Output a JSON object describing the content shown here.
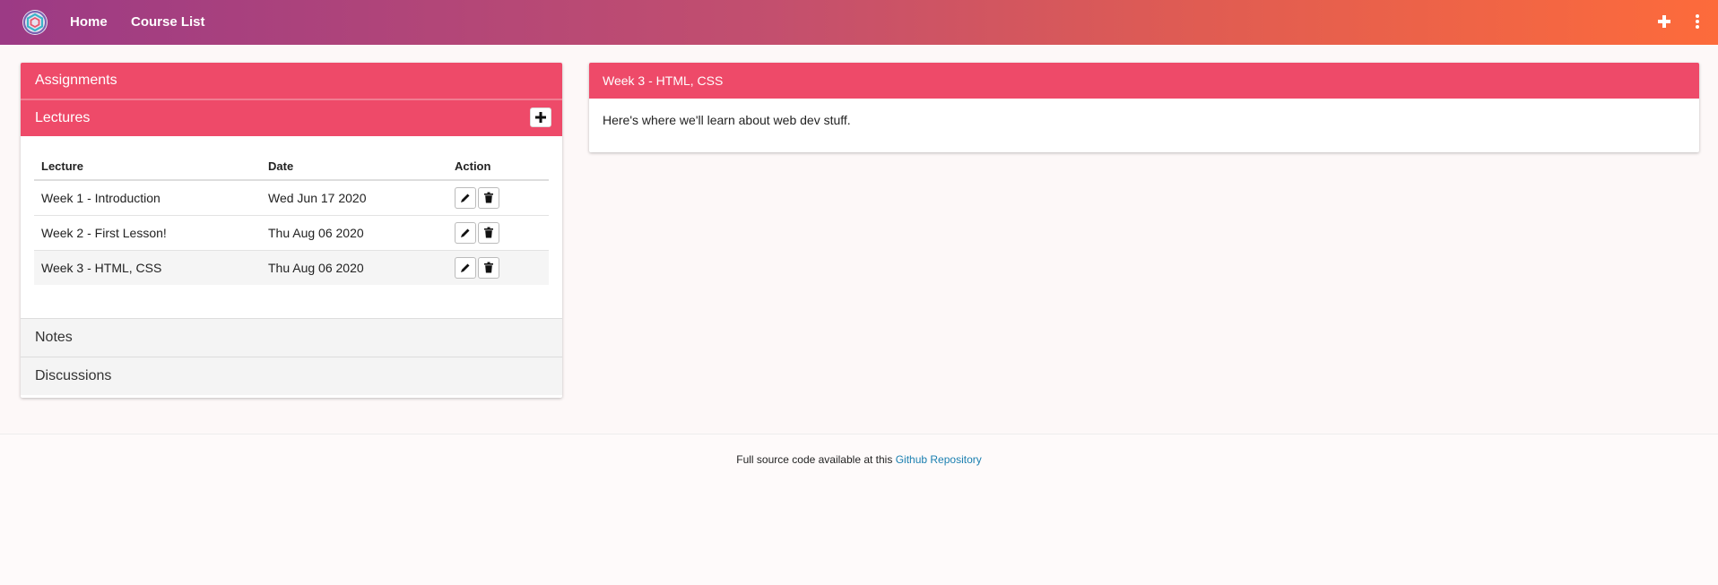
{
  "nav": {
    "home": "Home",
    "course_list": "Course List",
    "add_icon": "plus-icon",
    "more_icon": "more-vertical-icon",
    "gradient": [
      "#9c3a85",
      "#fd6b3b"
    ]
  },
  "sidebar": {
    "assignments_label": "Assignments",
    "lectures_label": "Lectures",
    "notes_label": "Notes",
    "discussions_label": "Discussions",
    "accent": "#ee4a69"
  },
  "lectures_table": {
    "headers": [
      "Lecture",
      "Date",
      "Action"
    ],
    "rows": [
      {
        "lecture": "Week 1 - Introduction",
        "date": "Wed Jun 17 2020"
      },
      {
        "lecture": "Week 2 - First Lesson!",
        "date": "Thu Aug 06 2020"
      },
      {
        "lecture": "Week 3 - HTML, CSS",
        "date": "Thu Aug 06 2020"
      }
    ]
  },
  "detail": {
    "title": "Week 3 - HTML, CSS",
    "body": "Here's where we'll learn about web dev stuff."
  },
  "footer": {
    "text": "Full source code available at this ",
    "link": "Github Repository"
  }
}
